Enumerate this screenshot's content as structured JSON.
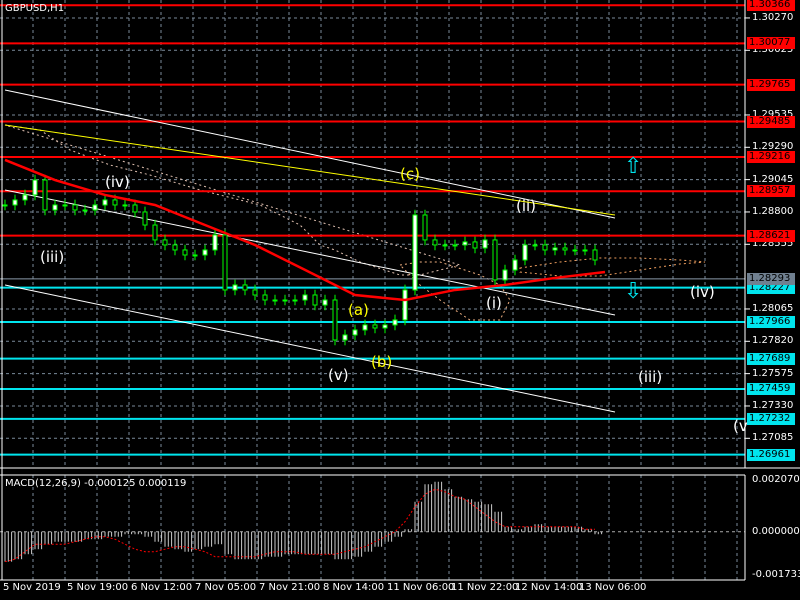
{
  "window": {
    "title": "GBPUSD,H1"
  },
  "colors": {
    "resistance": "#ff0000",
    "support": "#00e5ee",
    "current": "#708090",
    "bull": "#00ff00",
    "ma": "#ff0000",
    "wave_white": "#ffffff",
    "wave_yellow": "#ffff00"
  },
  "chart_data": [
    {
      "type": "candlestick",
      "title": "GBPUSD,H1",
      "ylim": [
        1.2686,
        1.30406
      ],
      "y_ticks": [
        "1.30270",
        "1.30025",
        "1.29535",
        "1.29290",
        "1.29045",
        "1.28800",
        "1.28555",
        "1.28065",
        "1.27820",
        "1.27575",
        "1.27330",
        "1.27085"
      ],
      "resistance_levels": [
        "1.30366",
        "1.30077",
        "1.29765",
        "1.29485",
        "1.29216",
        "1.28957",
        "1.28621"
      ],
      "support_levels": [
        "1.28227",
        "1.27966",
        "1.27689",
        "1.27459",
        "1.27232",
        "1.26961"
      ],
      "current_price": "1.28293",
      "close": [
        1.28853,
        1.28891,
        1.28929,
        1.29042,
        1.28815,
        1.28853,
        1.28853,
        1.28815,
        1.28815,
        1.28853,
        1.28891,
        1.28853,
        1.28853,
        1.288,
        1.28701,
        1.28588,
        1.2855,
        1.28512,
        1.28474,
        1.28474,
        1.28512,
        1.28626,
        1.28209,
        1.28247,
        1.28209,
        1.28171,
        1.28133,
        1.28133,
        1.28133,
        1.28133,
        1.28171,
        1.28095,
        1.28133,
        1.2783,
        1.27868,
        1.27906,
        1.27944,
        1.27921,
        1.27944,
        1.27982,
        1.28209,
        1.28777,
        1.28588,
        1.2855,
        1.2855,
        1.2855,
        1.28573,
        1.28527,
        1.28588,
        1.28285,
        1.2836,
        1.28436,
        1.2855,
        1.2855,
        1.28512,
        1.28527,
        1.28512,
        1.28512,
        1.28512,
        1.28436
      ],
      "ma_slow": [
        1.29194,
        1.29042,
        1.28929,
        1.28853,
        1.28701,
        1.2855,
        1.28361,
        1.28171,
        1.28133,
        1.28209,
        1.28247,
        1.283,
        1.28345
      ],
      "time_labels": [
        "5 Nov 2019",
        "5 Nov 19:00",
        "6 Nov 12:00",
        "7 Nov 05:00",
        "7 Nov 21:00",
        "8 Nov 14:00",
        "11 Nov 06:00",
        "11 Nov 22:00",
        "12 Nov 14:00",
        "13 Nov 06:00"
      ],
      "wave_labels": [
        {
          "text": "(iii)",
          "color": "white"
        },
        {
          "text": "(iv)",
          "color": "white"
        },
        {
          "text": "(v)",
          "color": "white"
        },
        {
          "text": "(a)",
          "color": "yellow"
        },
        {
          "text": "(b)",
          "color": "yellow"
        },
        {
          "text": "(c)",
          "color": "yellow"
        },
        {
          "text": "(ii)",
          "color": "white"
        },
        {
          "text": "(i)",
          "color": "white"
        },
        {
          "text": "(iv)",
          "color": "white"
        },
        {
          "text": "(iii)",
          "color": "white"
        },
        {
          "text": "(v",
          "color": "white"
        }
      ]
    },
    {
      "type": "bar",
      "title": "MACD(12,26,9) -0.000125 0.000119",
      "ylim": [
        -0.001733,
        0.00207
      ],
      "y_ticks": [
        "0.002070",
        "0.000000",
        "-0.001733"
      ],
      "histogram": [
        -0.0012,
        -0.0011,
        -0.0009,
        -0.0007,
        -0.0005,
        -0.0004,
        -0.0004,
        -0.0004,
        -0.0003,
        -0.0003,
        -0.0002,
        -0.0002,
        -0.0001,
        -0.0001,
        -0.0002,
        -0.0004,
        -0.0006,
        -0.0007,
        -0.0008,
        -0.0007,
        -0.0006,
        -0.0005,
        -0.0009,
        -0.0011,
        -0.0011,
        -0.0011,
        -0.001,
        -0.001,
        -0.0009,
        -0.0009,
        -0.0009,
        -0.0009,
        -0.0009,
        -0.0011,
        -0.0011,
        -0.001,
        -0.0008,
        -0.0006,
        -0.0004,
        -0.0002,
        0.0001,
        0.0012,
        0.0019,
        0.002,
        0.0017,
        0.0014,
        0.0013,
        0.0012,
        0.0011,
        0.0008,
        0.0002,
        0.0001,
        0.0002,
        0.0003,
        0.0002,
        0.0002,
        0.0002,
        0.0002,
        0.0001,
        -0.0001
      ],
      "signal": [
        -0.0012,
        -0.0011,
        -0.0008,
        -0.0005,
        -0.0005,
        -0.0005,
        -0.0005,
        -0.0004,
        -0.0003,
        -0.0002,
        -0.0002,
        -0.0003,
        -0.0005,
        -0.0007,
        -0.0008,
        -0.0008,
        -0.0007,
        -0.0006,
        -0.0006,
        -0.0007,
        -0.0008,
        -0.001,
        -0.001,
        -0.001,
        -0.001,
        -0.001,
        -0.0009,
        -0.0008,
        -0.0008,
        -0.0008,
        -0.0009,
        -0.0009,
        -0.0009,
        -0.0009,
        -0.0008,
        -0.0007,
        -0.0006,
        -0.0004,
        -0.0002,
        0.0,
        0.0004,
        0.001,
        0.0015,
        0.0017,
        0.0016,
        0.0014,
        0.0013,
        0.001,
        0.0007,
        0.0004,
        0.0002,
        0.0002,
        0.0002,
        0.0002,
        0.0002,
        0.0002,
        0.0002,
        0.0002,
        0.0001,
        0.0001
      ]
    }
  ]
}
